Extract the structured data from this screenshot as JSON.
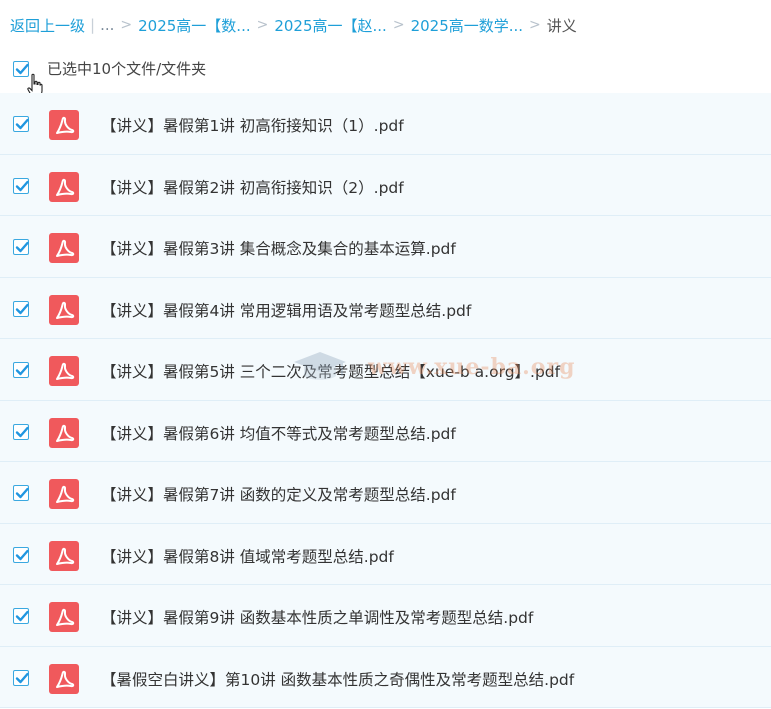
{
  "breadcrumb": {
    "back_label": "返回上一级",
    "ellipsis": "...",
    "items": [
      "2025高一【数...",
      "2025高一【赵...",
      "2025高一数学..."
    ],
    "current": "讲义",
    "separator": ">",
    "pipe": "|"
  },
  "selection": {
    "label": "已选中10个文件/文件夹",
    "checked": true
  },
  "files": [
    {
      "name": "【讲义】暑假第1讲 初高衔接知识（1）.pdf",
      "type": "pdf-icon",
      "checked": true
    },
    {
      "name": "【讲义】暑假第2讲 初高衔接知识（2）.pdf",
      "type": "pdf-icon",
      "checked": true
    },
    {
      "name": "【讲义】暑假第3讲 集合概念及集合的基本运算.pdf",
      "type": "pdf-icon",
      "checked": true
    },
    {
      "name": "【讲义】暑假第4讲 常用逻辑用语及常考题型总结.pdf",
      "type": "pdf-icon",
      "checked": true
    },
    {
      "name": "【讲义】暑假第5讲 三个二次及常考题型总结【xue-b a.org】.pdf",
      "type": "pdf-icon",
      "checked": true
    },
    {
      "name": "【讲义】暑假第6讲 均值不等式及常考题型总结.pdf",
      "type": "pdf-icon",
      "checked": true
    },
    {
      "name": "【讲义】暑假第7讲 函数的定义及常考题型总结.pdf",
      "type": "pdf-icon",
      "checked": true
    },
    {
      "name": "【讲义】暑假第8讲 值域常考题型总结.pdf",
      "type": "pdf-icon",
      "checked": true
    },
    {
      "name": "【讲义】暑假第9讲 函数基本性质之单调性及常考题型总结.pdf",
      "type": "pdf-icon",
      "checked": true
    },
    {
      "name": "【暑假空白讲义】第10讲 函数基本性质之奇偶性及常考题型总结.pdf",
      "type": "pdf-icon",
      "checked": true
    }
  ],
  "watermark": {
    "text": "www.xue-ba.org"
  },
  "colors": {
    "link": "#1e9fd8",
    "checkbox": "#3aa8e0",
    "pdf_red": "#f0595c",
    "row_bg": "#f4fafd"
  }
}
